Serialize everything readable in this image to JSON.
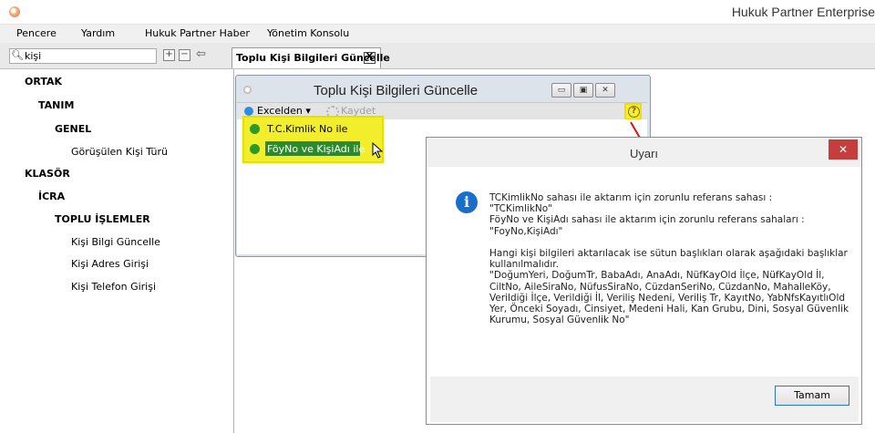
{
  "app": {
    "title": "Hukuk Partner Enterprise"
  },
  "menu": [
    "Pencere",
    "Yardım",
    "Hukuk Partner Haber",
    "Yönetim Konsolu"
  ],
  "search": {
    "value": "kişi"
  },
  "document_tab": {
    "label": "Toplu Kişi Bilgileri Güncelle",
    "close": "X"
  },
  "tree": [
    {
      "label": "ORTAK",
      "bold": true
    },
    {
      "label": "TANIM",
      "bold": true
    },
    {
      "label": "GENEL",
      "bold": true
    },
    {
      "label": "Görüşülen Kişi Türü",
      "bold": false
    },
    {
      "label": "KLASÖR",
      "bold": true
    },
    {
      "label": "İCRA",
      "bold": true
    },
    {
      "label": "TOPLU İŞLEMLER",
      "bold": true
    },
    {
      "label": "Kişi Bilgi Güncelle",
      "bold": false
    },
    {
      "label": "Kişi Adres Girişi",
      "bold": false
    },
    {
      "label": "Kişi Telefon Girişi",
      "bold": false
    }
  ],
  "inner_window": {
    "title": "Toplu Kişi Bilgileri Güncelle",
    "excel_label": "Excelden ▾",
    "save_label": "Kaydet",
    "help": "?",
    "dropdown": [
      "T.C.Kimlik No ile",
      "FöyNo ve KişiAdı ile"
    ]
  },
  "dialog": {
    "title": "Uyarı",
    "close": "✕",
    "info": "i",
    "message": "TCKimlikNo sahası ile aktarım için zorunlu referans sahası :\n\"TCKimlikNo\"\nFöyNo ve KişiAdı sahası ile aktarım için zorunlu referans sahaları :\n\"FoyNo,KişiAdı\"\n\nHangi kişi bilgileri aktarılacak ise sütun başlıkları olarak aşağıdaki başlıklar kullanılmalıdır.\n\"DoğumYeri, DoğumTr, BabaAdı, AnaAdı, NüfKayOld İlçe, NüfKayOld İl, CiltNo, AileSiraNo, NüfusSiraNo, CüzdanSeriNo, CüzdanNo, MahalleKöy, Verildiği İlçe, Verildiği İl, Veriliş Nedeni, Veriliş Tr, KayıtNo, YabNfsKayıtlıOld Yer, Önceki Soyadı, Cinsiyet, Medeni Hali, Kan Grubu, Dini, Sosyal Güvenlik Kurumu, Sosyal Güvenlik No\"",
    "ok_label": "Tamam"
  },
  "colors": {
    "highlight_yellow": "#f3ee2c",
    "selection_green": "#2c8a2c",
    "close_red": "#c73c3c",
    "info_blue": "#1a6ecb"
  }
}
